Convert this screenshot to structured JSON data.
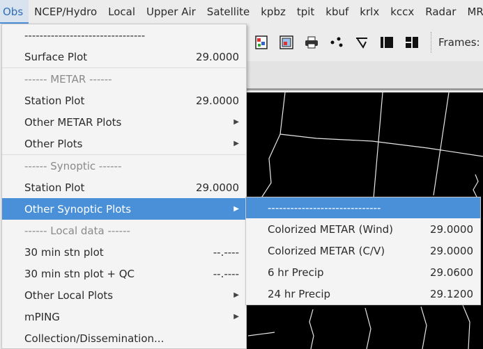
{
  "menubar": {
    "items": [
      "Obs",
      "NCEP/Hydro",
      "Local",
      "Upper Air",
      "Satellite",
      "kpbz",
      "tpit",
      "kbuf",
      "krlx",
      "kccx",
      "Radar",
      "MRMS"
    ]
  },
  "toolbar": {
    "frames_label": "Frames:",
    "icons": [
      "color-map-icon",
      "image-properties-icon",
      "print-icon",
      "points-icon",
      "draw-icon",
      "single-panel-icon",
      "four-panel-icon"
    ]
  },
  "obs_menu": {
    "tearoff": "--------------------------------",
    "surface_plot": {
      "label": "Surface Plot",
      "value": "29.0000"
    },
    "metar_header": "------ METAR ------",
    "metar_station_plot": {
      "label": "Station Plot",
      "value": "29.0000"
    },
    "other_metar_plots": "Other METAR Plots",
    "other_plots": "Other Plots",
    "synoptic_header": "------ Synoptic ------",
    "synoptic_station_plot": {
      "label": "Station Plot",
      "value": "29.0000"
    },
    "other_synoptic_plots": "Other Synoptic Plots",
    "local_header": "------ Local data ------",
    "stn_plot_30": {
      "label": "30 min stn plot",
      "value": "--.----"
    },
    "stn_plot_30_qc": {
      "label": "30 min stn plot + QC",
      "value": "--.----"
    },
    "other_local_plots": "Other Local Plots",
    "mping": "mPING",
    "collection": "Collection/Dissemination..."
  },
  "synoptic_submenu": {
    "tearoff": "------------------------------",
    "items": [
      {
        "label": "Colorized METAR (Wind)",
        "value": "29.0000"
      },
      {
        "label": "Colorized METAR (C/V)",
        "value": "29.0000"
      },
      {
        "label": "6 hr Precip",
        "value": "29.0600"
      },
      {
        "label": "24 hr Precip",
        "value": "29.1200"
      }
    ]
  },
  "colors": {
    "accent": "#4a90d9",
    "menu_bg": "#f4f4f4",
    "map_bg": "#000000"
  }
}
